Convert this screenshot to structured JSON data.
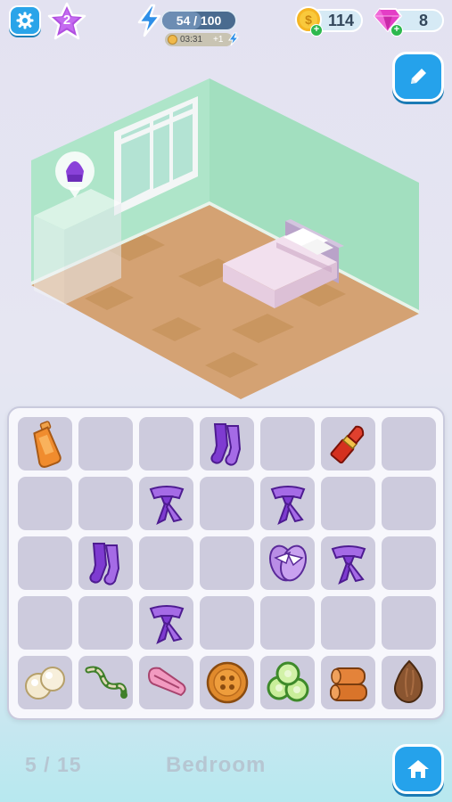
{
  "hud": {
    "level": "2",
    "energy_label": "54 / 100",
    "energy_fraction": 0.54,
    "energy_timer": "03:31",
    "energy_timer_plus": "+1",
    "coins": "114",
    "gems": "8"
  },
  "room": {
    "progress": "5 / 15",
    "name": "Bedroom",
    "hint_icon": "sweater-icon"
  },
  "board": {
    "rows": 5,
    "cols": 7,
    "cells": [
      [
        "bottle",
        "",
        "",
        "socks",
        "",
        "lipstick",
        ""
      ],
      [
        "",
        "",
        "scarf",
        "",
        "scarf",
        "",
        ""
      ],
      [
        "",
        "socks",
        "",
        "",
        "slippers",
        "scarf",
        ""
      ],
      [
        "",
        "",
        "scarf",
        "",
        "",
        "",
        ""
      ],
      [
        "pearls",
        "twisted-rope",
        "hairclip",
        "button",
        "cucumber-slices",
        "rolled-towel",
        "almond"
      ]
    ]
  },
  "colors": {
    "accent": "#25a2eb",
    "wall": "#a9e3c5",
    "floor": "#d4a273",
    "cell": "#cdcbdd",
    "item_purple": "#7e3bd1"
  }
}
